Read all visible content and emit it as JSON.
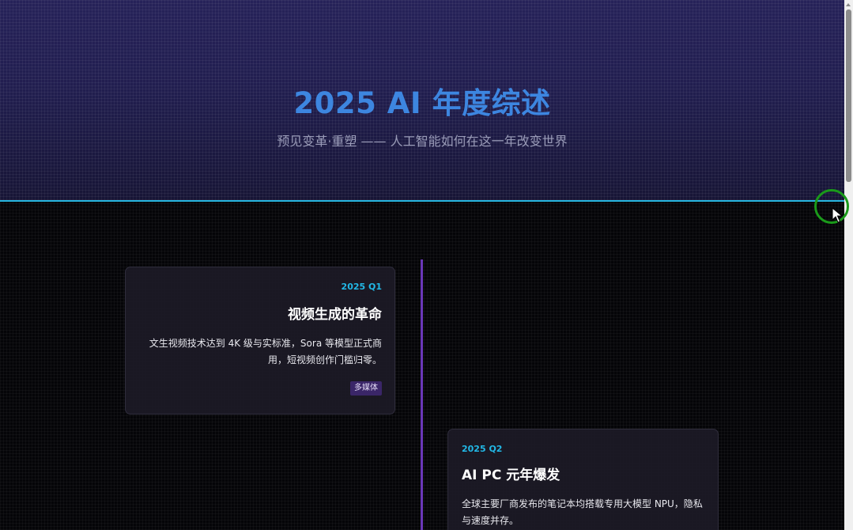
{
  "hero": {
    "title": "2025 AI 年度综述",
    "subtitle": "预见变革·重塑 —— 人工智能如何在这一年改变世界"
  },
  "timeline": {
    "items": [
      {
        "date": "2025 Q1",
        "title": "视频生成的革命",
        "description": "文生视频技术达到 4K 级与实标准，Sora 等模型正式商用，短视频创作门槛归零。",
        "tag": "多媒体"
      },
      {
        "date": "2025 Q2",
        "title": "AI PC 元年爆发",
        "description": "全球主要厂商发布的笔记本均搭载专用大模型 NPU，隐私与速度并存。"
      }
    ]
  },
  "colors": {
    "hero_title": "#3d86e0",
    "accent_cyan": "#22b8e6",
    "timeline_line": "#6a37b8",
    "tag_bg": "#3a2668",
    "cursor_ring": "#1a9a1a"
  },
  "icons": {
    "cursor": "mouse-pointer-icon",
    "scroll_up": "scroll-up-arrow-icon"
  }
}
